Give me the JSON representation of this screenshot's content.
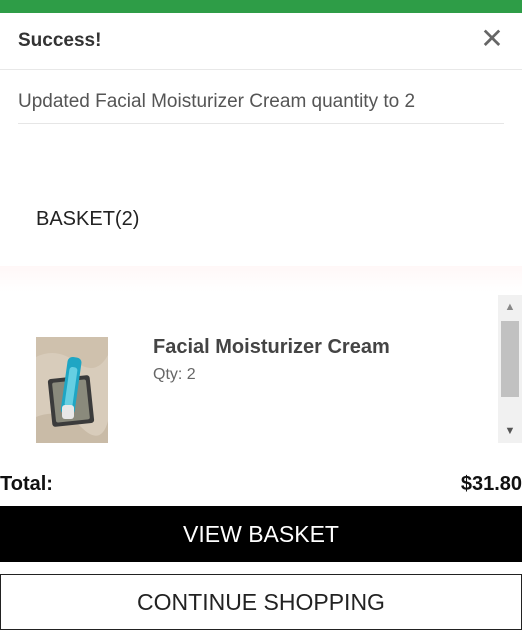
{
  "colors": {
    "success": "#2e9d47",
    "button_primary_bg": "#000000"
  },
  "alert": {
    "title": "Success!",
    "close_icon": "close-icon",
    "close_glyph": "✕",
    "message": "Updated Facial Moisturizer Cream quantity to 2"
  },
  "basket": {
    "title": "BASKET(2)",
    "items": [
      {
        "name": "Facial Moisturizer Cream",
        "qty_text": "Qty: 2",
        "image": "product-image"
      }
    ],
    "scroll_up_glyph": "▲",
    "scroll_down_glyph": "▼"
  },
  "summary": {
    "total_label": "Total:",
    "total_value": "$31.80"
  },
  "actions": {
    "view_basket": "VIEW BASKET",
    "continue_shopping": "CONTINUE SHOPPING"
  }
}
